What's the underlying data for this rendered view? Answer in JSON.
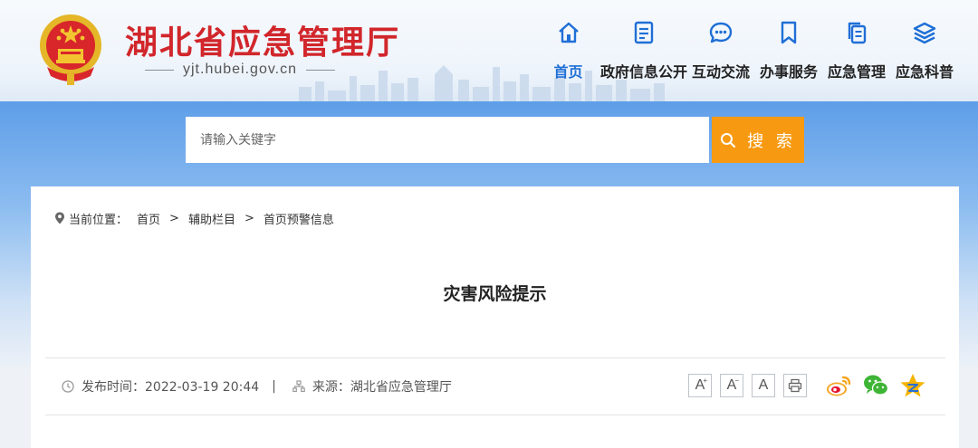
{
  "header": {
    "site_title": "湖北省应急管理厅",
    "domain": "yjt.hubei.gov.cn"
  },
  "nav": [
    {
      "label": "首页",
      "icon": "home-icon",
      "active": true
    },
    {
      "label": "政府信息公开",
      "icon": "document-icon",
      "active": false
    },
    {
      "label": "互动交流",
      "icon": "chat-bubble-icon",
      "active": false
    },
    {
      "label": "办事服务",
      "icon": "bookmark-icon",
      "active": false
    },
    {
      "label": "应急管理",
      "icon": "copy-icon",
      "active": false
    },
    {
      "label": "应急科普",
      "icon": "layers-icon",
      "active": false
    }
  ],
  "search": {
    "placeholder": "请输入关键字",
    "button_label": "搜 索"
  },
  "breadcrumb": {
    "prefix": "当前位置：",
    "items": [
      "首页",
      "辅助栏目",
      "首页预警信息"
    ],
    "separator": ">"
  },
  "article": {
    "title": "灾害风险提示",
    "publish_label": "发布时间：2022-03-19 20:44",
    "divider": "|",
    "source_label": "来源：湖北省应急管理厅"
  },
  "tools": {
    "font_larger": "A",
    "font_smaller": "A",
    "font_default": "A",
    "print_icon": "printer-icon"
  },
  "share": [
    "weibo-icon",
    "wechat-icon",
    "qzone-icon"
  ],
  "colors": {
    "title_red": "#d1262b",
    "nav_active": "#1f6fd6",
    "search_button": "#f79a12",
    "band_blue": "#5e9ee8"
  }
}
